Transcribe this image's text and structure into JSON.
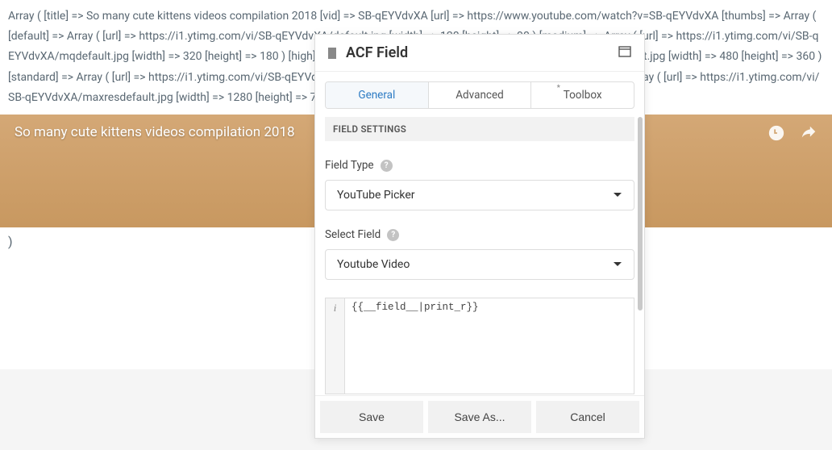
{
  "bg": {
    "dump": "Array ( [title] => So many cute kittens videos compilation 2018 [vid] => SB-qEYVdvXA [url] => https://www.youtube.com/watch?v=SB-qEYVdvXA [thumbs] => Array ( [default] => Array ( [url] => https://i1.ytimg.com/vi/SB-qEYVdvXA/default.jpg [width] => 120 [height] => 90 ) [medium] => Array ( [url] => https://i1.ytimg.com/vi/SB-qEYVdvXA/mqdefault.jpg [width] => 320 [height] => 180 ) [high] => Array ( [url] => https://i1.ytimg.com/vi/SB-qEYVdvXA/hqdefault.jpg [width] => 480 [height] => 360 ) [standard] => Array ( [url] => https://i1.ytimg.com/vi/SB-qEYVdvXA/sddefault.jpg [width] => 640 [height] => 480 ) [maxres] => Array ( [url] => https://i1.ytimg.com/vi/SB-qEYVdvXA/maxresdefault.jpg [width] => 1280 [height] => 720 ) ) )",
    "paren": ")",
    "video_title": "So many cute kittens videos compilation 2018"
  },
  "modal": {
    "title": "ACF Field",
    "tabs": {
      "general": "General",
      "advanced": "Advanced",
      "toolbox": "Toolbox"
    },
    "section": "FIELD SETTINGS",
    "field_type_label": "Field Type",
    "field_type_value": "YouTube Picker",
    "select_field_label": "Select Field",
    "select_field_value": "Youtube Video",
    "code_gutter": "i",
    "code_value": "{{__field__|print_r}}",
    "buttons": {
      "save": "Save",
      "save_as": "Save As...",
      "cancel": "Cancel"
    }
  }
}
